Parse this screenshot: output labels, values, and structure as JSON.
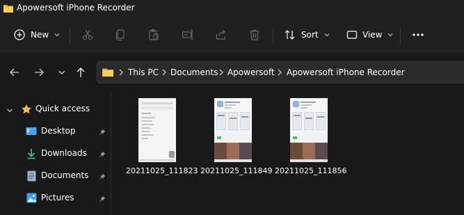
{
  "window": {
    "title": "Apowersoft iPhone Recorder"
  },
  "toolbar": {
    "new_label": "New",
    "sort_label": "Sort",
    "view_label": "View"
  },
  "breadcrumb": [
    "This PC",
    "Documents",
    "Apowersoft",
    "Apowersoft iPhone Recorder"
  ],
  "sidebar": {
    "items": [
      {
        "label": "Quick access",
        "icon": "star-icon"
      },
      {
        "label": "Desktop",
        "icon": "desktop-icon"
      },
      {
        "label": "Downloads",
        "icon": "download-icon"
      },
      {
        "label": "Documents",
        "icon": "document-icon"
      },
      {
        "label": "Pictures",
        "icon": "picture-icon"
      }
    ]
  },
  "files": [
    {
      "name": "20211025_111823"
    },
    {
      "name": "20211025_111849"
    },
    {
      "name": "20211025_111856"
    }
  ],
  "colors": {
    "folder": "#f3c24a",
    "star": "#f3c24a",
    "accent": "#4aa6e8",
    "background": "#191919"
  }
}
